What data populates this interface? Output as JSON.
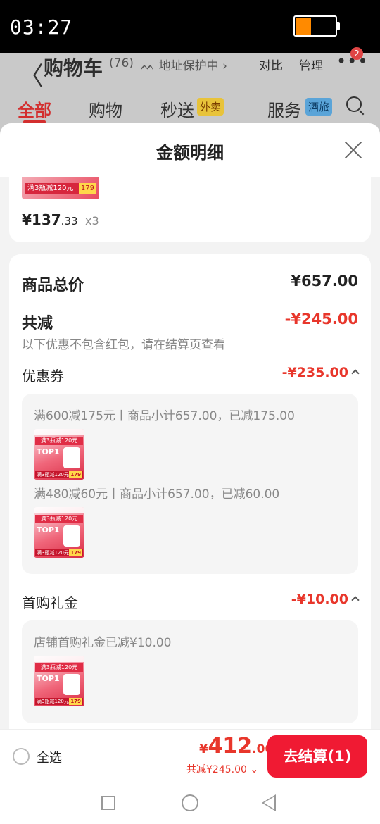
{
  "status": {
    "time": "03:27",
    "battery_level": 0.4
  },
  "background": {
    "back_glyph": "〈",
    "title": "购物车",
    "count": "(76)",
    "address": "ᨓ 地址保护中 ›",
    "compare": "对比",
    "manage": "管理",
    "more": "•••",
    "badge": "2",
    "tabs": [
      {
        "label": "全部"
      },
      {
        "label": "购物"
      },
      {
        "label": "秒送"
      },
      {
        "label": "服务"
      }
    ],
    "chip_waimai": "外卖",
    "chip_hotel": "酒旅"
  },
  "sheet": {
    "title": "金额明细",
    "product": {
      "promo": "满3瓶减120元",
      "promo_price": "179",
      "price_int": "¥137",
      "price_dec": ".33",
      "qty": "x3"
    },
    "total_label": "商品总价",
    "total_value": "¥657.00",
    "discount_label": "共减",
    "discount_value": "-¥245.00",
    "discount_note": "以下优惠不包含红包，请在结算页查看",
    "coupon_label": "优惠券",
    "coupon_value": "-¥235.00",
    "coupons": [
      {
        "text": "满600减175元丨商品小计657.00，已减175.00"
      },
      {
        "text": "满480减60元丨商品小计657.00，已减60.00"
      }
    ],
    "gift_label": "首购礼金",
    "gift_value": "-¥10.00",
    "gift_text": "店铺首购礼金已减¥10.00",
    "thumb": {
      "header": "满3瓶减120元",
      "top1": "TOP1",
      "price": "179"
    }
  },
  "bottom": {
    "select_all": "全选",
    "currency": "¥",
    "total_int": "412",
    "total_dec": ".00",
    "total_sub": "共减¥245.00 ⌄",
    "checkout": "去结算(1)"
  }
}
